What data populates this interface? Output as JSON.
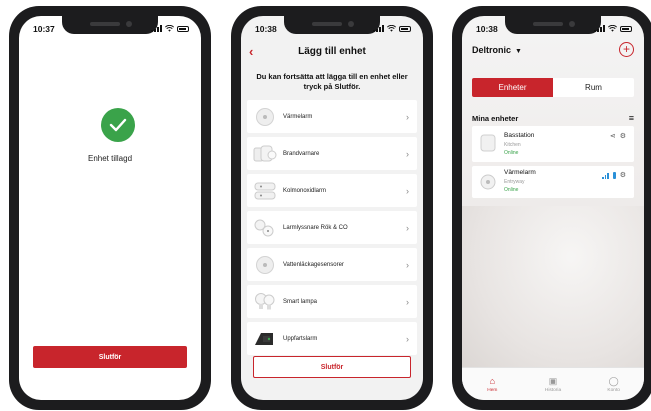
{
  "colors": {
    "accent": "#c8252c",
    "success": "#3aa34a",
    "signal": "#2a90d8"
  },
  "phone1": {
    "time": "10:37",
    "message": "Enhet tillagd",
    "finish_label": "Slutför",
    "icon": "check-circle-icon"
  },
  "phone2": {
    "time": "10:38",
    "title": "Lägg till enhet",
    "hint": "Du kan fortsätta att lägga till en enhet eller tryck på Slutför.",
    "items": [
      {
        "label": "Värmelarm",
        "icon": "heat-alarm-icon"
      },
      {
        "label": "Brandvarnare",
        "icon": "smoke-detector-icon"
      },
      {
        "label": "Kolmonoxidlarm",
        "icon": "co-alarm-icon"
      },
      {
        "label": "Larmlyssnare Rök & CO",
        "icon": "alarm-listener-icon"
      },
      {
        "label": "Vattenläckagesensorer",
        "icon": "water-leak-sensor-icon"
      },
      {
        "label": "Smart lampa",
        "icon": "smart-bulb-icon"
      },
      {
        "label": "Uppfartslarm",
        "icon": "driveway-alarm-icon"
      }
    ],
    "finish_label": "Slutför"
  },
  "phone3": {
    "time": "10:38",
    "brand": "Deltronic",
    "segments": [
      "Enheter",
      "Rum"
    ],
    "active_segment": "Enheter",
    "section_title": "Mina enheter",
    "devices": [
      {
        "name": "Basstation",
        "room": "Kitchen",
        "status": "Online"
      },
      {
        "name": "Värmelarm",
        "room": "Entryway",
        "status": "Online"
      }
    ],
    "tabs": [
      {
        "label": "Hem",
        "icon": "home-icon",
        "active": true
      },
      {
        "label": "Historia",
        "icon": "history-icon",
        "active": false
      },
      {
        "label": "Konto",
        "icon": "account-icon",
        "active": false
      }
    ]
  }
}
